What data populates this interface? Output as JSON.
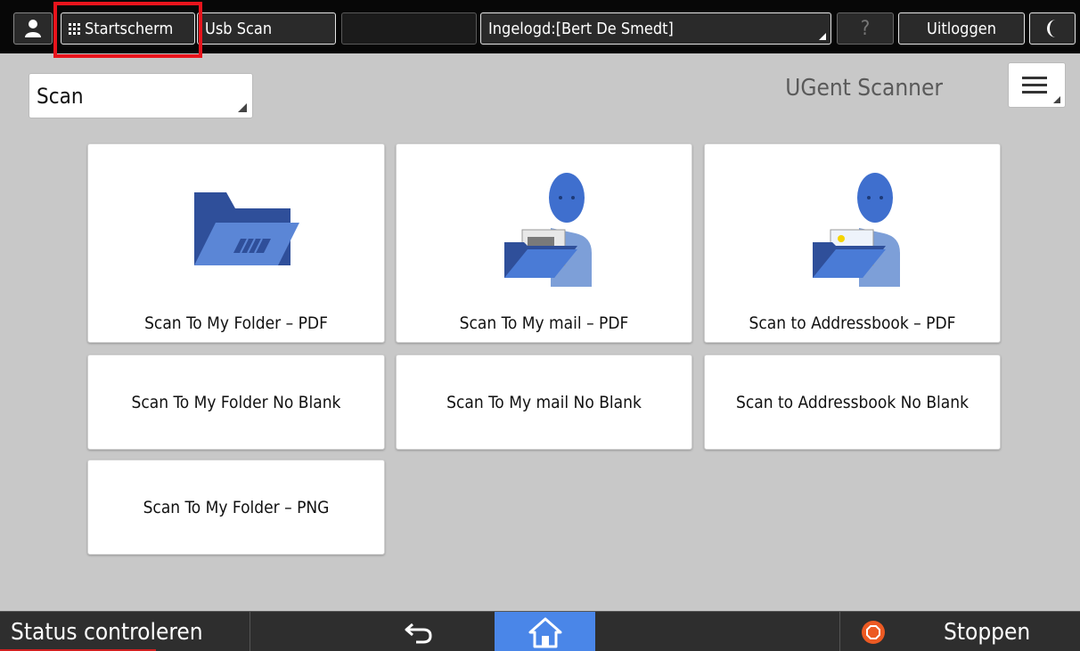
{
  "topbar": {
    "home_label": "Startscherm",
    "usb_label": "Usb Scan",
    "login_label": "Ingelogd:[Bert De Smedt]",
    "help_label": "?",
    "logout_label": "Uitloggen"
  },
  "main": {
    "function_select": "Scan",
    "app_title": "UGent Scanner"
  },
  "tiles": [
    {
      "label": "Scan To My Folder – PDF",
      "icon": "folder-icon"
    },
    {
      "label": "Scan To My mail – PDF",
      "icon": "person-scan-icon"
    },
    {
      "label": "Scan to Addressbook – PDF",
      "icon": "person-scan-color-icon"
    },
    {
      "label": "Scan To My Folder No Blank"
    },
    {
      "label": "Scan To My mail No Blank"
    },
    {
      "label": "Scan to Addressbook No Blank"
    },
    {
      "label": "Scan To My Folder – PNG"
    }
  ],
  "bottombar": {
    "status_label": "Status controleren",
    "stop_label": "Stoppen"
  },
  "colors": {
    "accent_blue": "#4a86e8",
    "highlight_red": "#e8141c",
    "stop_orange": "#ec5a23"
  }
}
